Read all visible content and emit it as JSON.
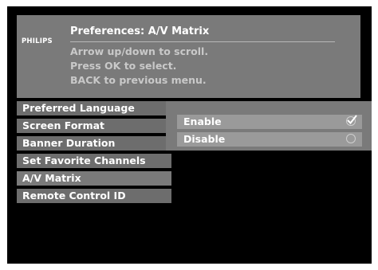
{
  "header": {
    "brand": "PHILIPS",
    "title": "Preferences: A/V Matrix",
    "instructions": [
      "Arrow up/down to scroll.",
      "Press OK to select.",
      "BACK to previous menu."
    ]
  },
  "menu": {
    "items": [
      {
        "label": "Preferred Language"
      },
      {
        "label": "Screen Format"
      },
      {
        "label": "Banner Duration"
      },
      {
        "label": "Set Favorite Channels"
      },
      {
        "label": "A/V Matrix"
      },
      {
        "label": "Remote Control ID"
      }
    ],
    "active": "A/V Matrix"
  },
  "options": [
    {
      "label": "Enable",
      "selected": true,
      "icon": "checkmark-radio-icon"
    },
    {
      "label": "Disable",
      "selected": false,
      "icon": "empty-radio-icon"
    }
  ]
}
